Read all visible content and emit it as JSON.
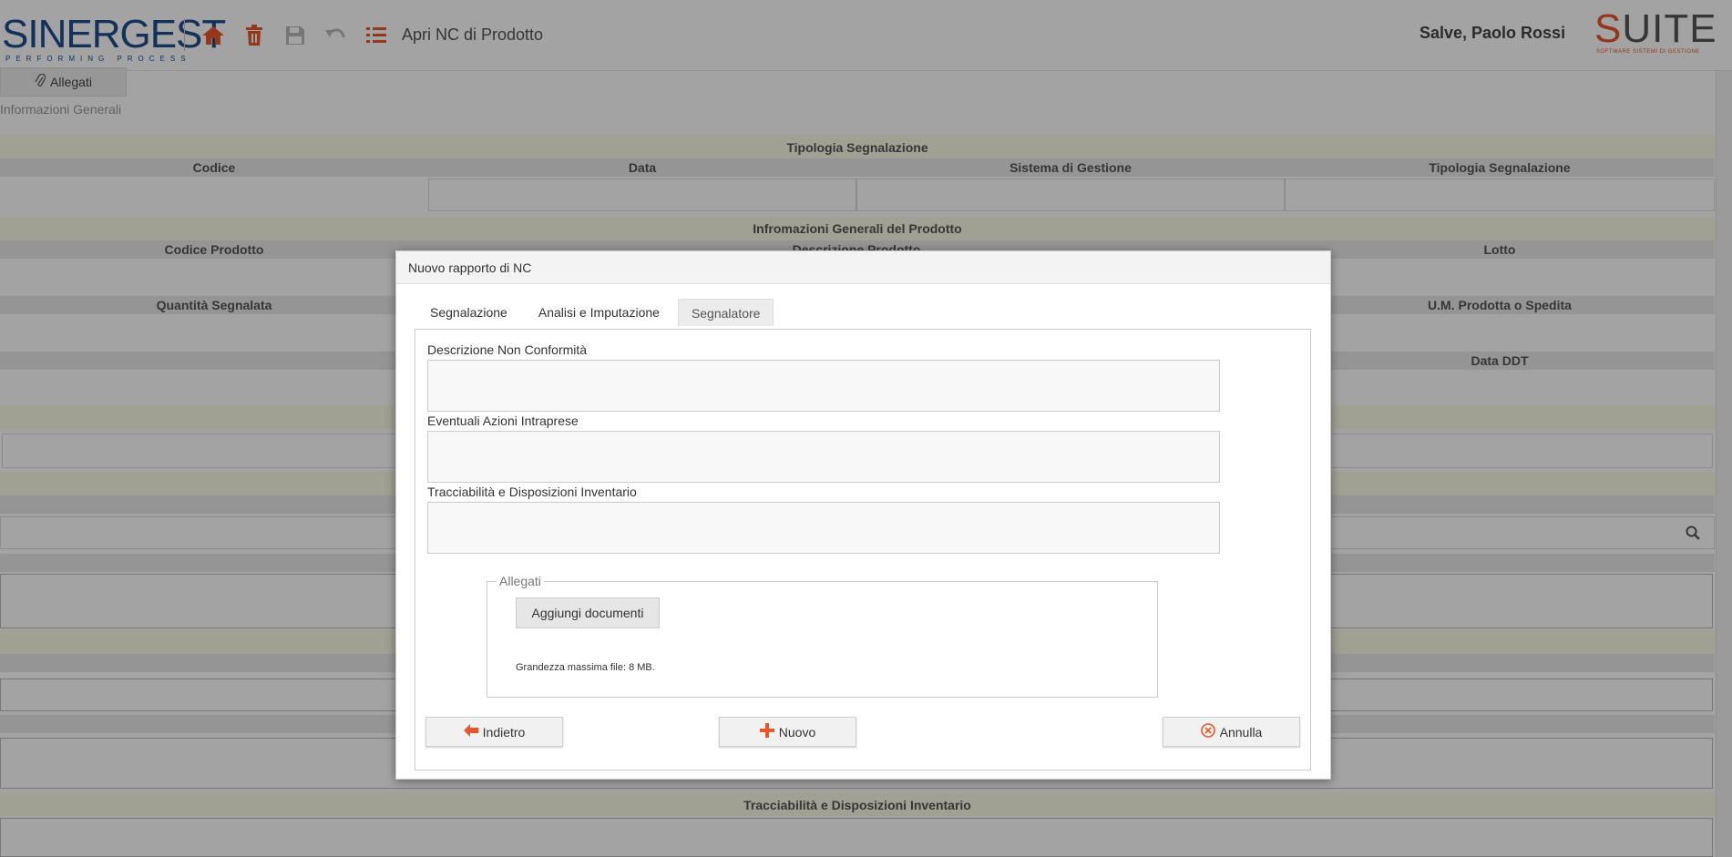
{
  "header": {
    "logo_text": "SINERGEST",
    "logo_tagline": "PERFORMING PROCESS",
    "page_title": "Apri NC di Prodotto",
    "greeting": "Salve, Paolo Rossi",
    "suite_logo_text": "UITE",
    "suite_logo_s": "S",
    "suite_tagline": "SOFTWARE SISTEMI DI GESTIONE",
    "toolbar_icons": [
      "home-icon",
      "trash-icon",
      "save-icon",
      "undo-icon",
      "list-icon"
    ]
  },
  "actions": {
    "allegati_label": "Allegati"
  },
  "background_form": {
    "section_title": "Informazioni Generali",
    "tipologia_section": "Tipologia Segnalazione",
    "col_codice": "Codice",
    "col_data": "Data",
    "col_sistema": "Sistema di Gestione",
    "col_tipologia": "Tipologia Segnalazione",
    "prodotto_section": "Infromazioni Generali del Prodotto",
    "col_codice_prodotto": "Codice Prodotto",
    "col_descrizione_prodotto": "Descrizione Prodotto",
    "col_lotto": "Lotto",
    "col_quantita": "Quantità Segnalata",
    "col_um": "U.M. Prodotta o Spedita",
    "col_data_ddt": "Data DDT",
    "bottom_section": "Tracciabilità e Disposizioni Inventario"
  },
  "dialog": {
    "title": "Nuovo rapporto di NC",
    "tabs": [
      "Segnalazione",
      "Analisi e Imputazione",
      "Segnalatore"
    ],
    "active_tab": "Segnalatore",
    "field1_label": "Descrizione Non Conformità",
    "field2_label": "Eventuali Azioni Intraprese",
    "field3_label": "Tracciabilità e Disposizioni Inventario",
    "attachments_legend": "Allegati",
    "add_docs_label": "Aggiungi documenti",
    "max_size_note": "Grandezza massima file: 8 MB.",
    "back_label": "Indietro",
    "new_label": "Nuovo",
    "cancel_label": "Annulla"
  },
  "colors": {
    "accent": "#e8562a",
    "brand_blue": "#1f4e8f"
  }
}
